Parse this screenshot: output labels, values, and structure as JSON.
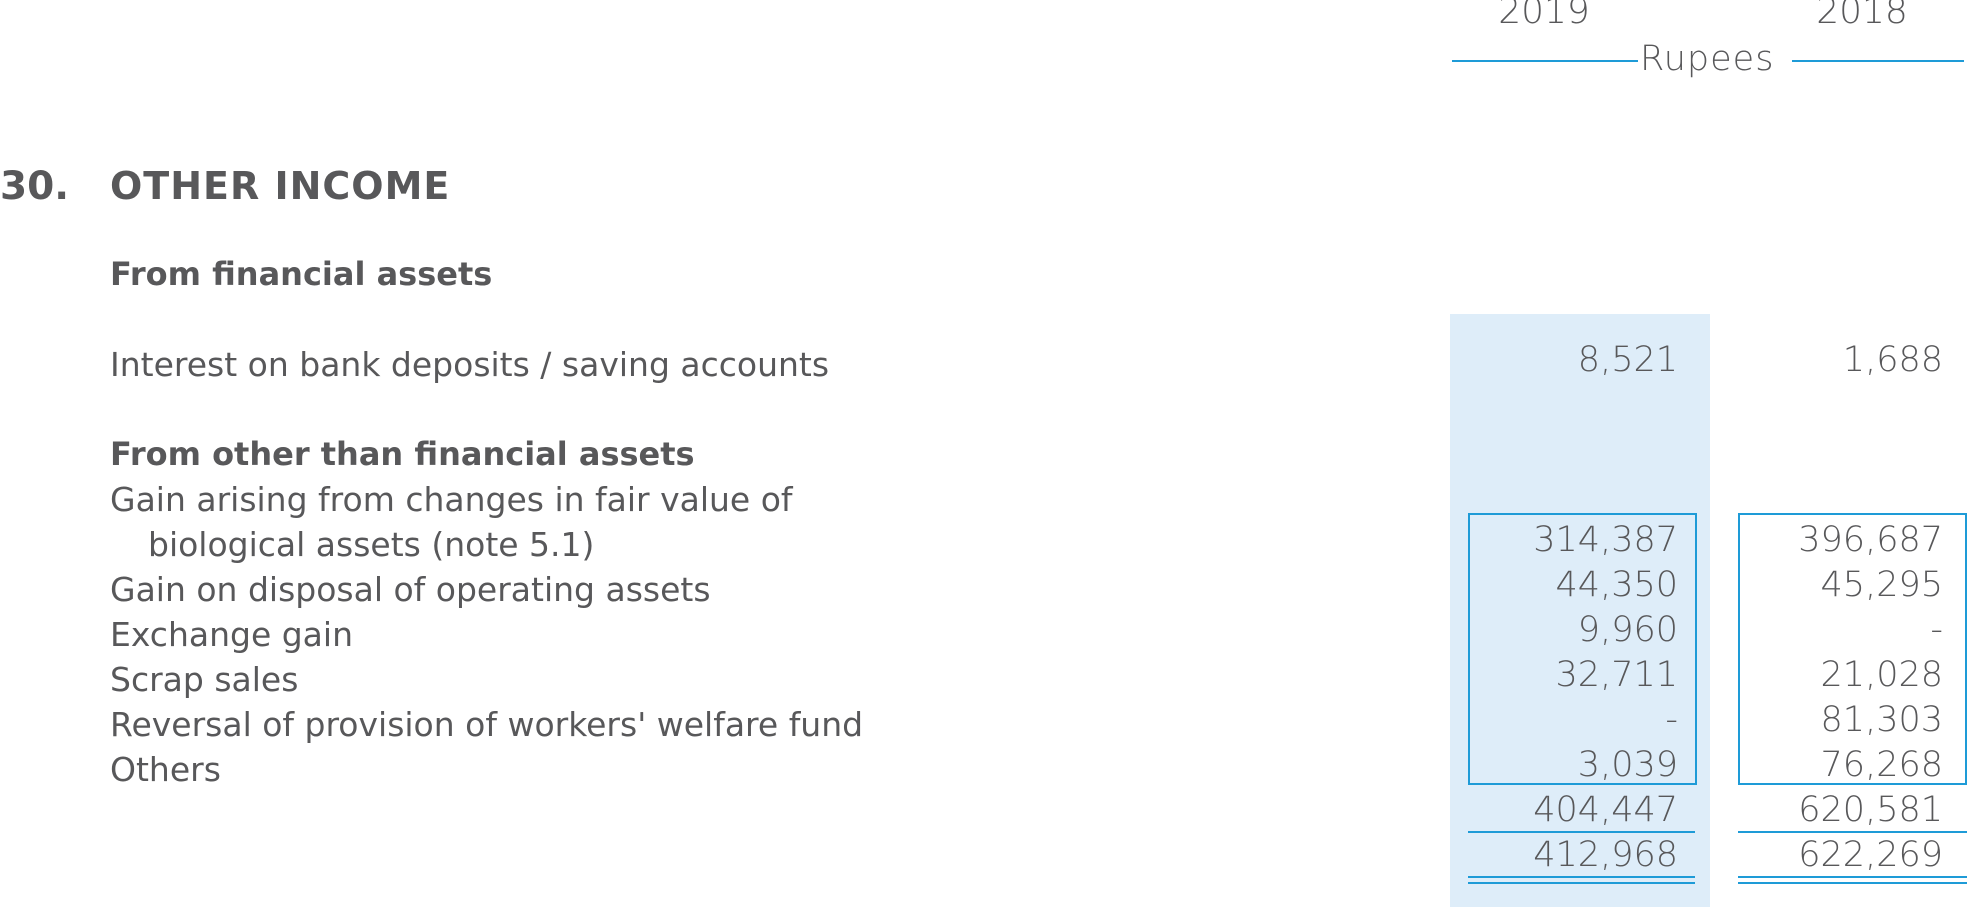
{
  "header": {
    "year_current": "2019",
    "year_prior": "2018",
    "currency": "Rupees"
  },
  "note": {
    "number": "30.",
    "title": "OTHER INCOME"
  },
  "financial_assets": {
    "heading": "From financial assets",
    "rows": [
      {
        "label": "Interest on bank deposits / saving accounts",
        "current": "8,521",
        "prior": "1,688"
      }
    ]
  },
  "non_financial_assets": {
    "heading": "From other than financial assets",
    "rows": [
      {
        "label": "Gain arising from changes in fair value of",
        "label_continued": "biological assets (note 5.1)",
        "current": "314,387",
        "prior": "396,687"
      },
      {
        "label": "Gain on disposal of operating assets",
        "current": "44,350",
        "prior": "45,295"
      },
      {
        "label": "Exchange gain",
        "current": "9,960",
        "prior": "-"
      },
      {
        "label": "Scrap sales",
        "current": "32,711",
        "prior": "21,028"
      },
      {
        "label": "Reversal of provision of workers' welfare fund",
        "current": "-",
        "prior": "81,303"
      },
      {
        "label": "Others",
        "current": "3,039",
        "prior": "76,268"
      }
    ],
    "subtotal": {
      "current": "404,447",
      "prior": "620,581"
    }
  },
  "total": {
    "current": "412,968",
    "prior": "622,269"
  },
  "colors": {
    "text": "#58585a",
    "accent_rule": "#1e9bd7",
    "shade": "#deedf9"
  }
}
